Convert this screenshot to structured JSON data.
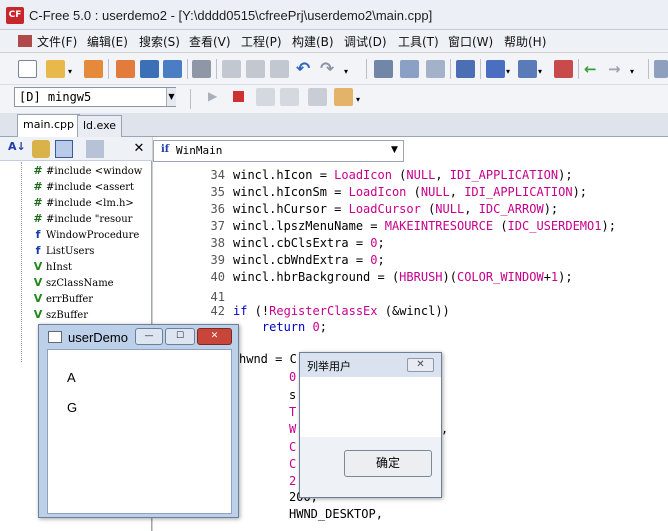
{
  "window": {
    "title": "C-Free 5.0 : userdemo2 - [Y:\\dddd0515\\cfreePrj\\userdemo2\\main.cpp]",
    "icon": "cfree-app-icon"
  },
  "menu": [
    {
      "label": "文件(F)"
    },
    {
      "label": "编辑(E)"
    },
    {
      "label": "搜索(S)"
    },
    {
      "label": "查看(V)"
    },
    {
      "label": "工程(P)"
    },
    {
      "label": "构建(B)"
    },
    {
      "label": "调试(D)"
    },
    {
      "label": "工具(T)"
    },
    {
      "label": "窗口(W)"
    },
    {
      "label": "帮助(H)"
    }
  ],
  "compiler": {
    "selected": "[D] mingw5"
  },
  "tabs": [
    {
      "label": "main.cpp",
      "active": true
    },
    {
      "label": "ld.exe",
      "active": false
    }
  ],
  "function_box": {
    "value": "WinMain"
  },
  "tree": [
    {
      "glyph": "#",
      "label": "#include <window"
    },
    {
      "glyph": "#",
      "label": "#include <assert"
    },
    {
      "glyph": "#",
      "label": "#include <lm.h>"
    },
    {
      "glyph": "#",
      "label": "#include \"resour"
    },
    {
      "glyph": "f",
      "label": "WindowProcedure"
    },
    {
      "glyph": "f",
      "label": "ListUsers"
    },
    {
      "glyph": "V",
      "label": "hInst"
    },
    {
      "glyph": "V",
      "label": "szClassName"
    },
    {
      "glyph": "V",
      "label": "errBuffer"
    },
    {
      "glyph": "V",
      "label": "szBuffer"
    }
  ],
  "code_lines": [
    {
      "n": "34",
      "text": "wincl.hIcon = LoadIcon (NULL, IDI_APPLICATION);"
    },
    {
      "n": "35",
      "text": "wincl.hIconSm = LoadIcon (NULL, IDI_APPLICATION);"
    },
    {
      "n": "36",
      "text": "wincl.hCursor = LoadCursor (NULL, IDC_ARROW);"
    },
    {
      "n": "37",
      "text": "wincl.lpszMenuName = MAKEINTRESOURCE (IDC_USERDEMO1);"
    },
    {
      "n": "38",
      "text": "wincl.cbClsExtra = 0;"
    },
    {
      "n": "39",
      "text": "wincl.cbWndExtra = 0;"
    },
    {
      "n": "40",
      "text": "wincl.hbrBackground = (HBRUSH)(COLOR_WINDOW+1);"
    },
    {
      "n": "41",
      "text": ""
    },
    {
      "n": "42",
      "text": "if (!RegisterClassEx (&wincl))"
    },
    {
      "n": "",
      "text": "    return 0;"
    }
  ],
  "code_fragments": {
    "hwnd": "hwnd = C",
    "l1": "0",
    "l2": "s",
    "l3": "T",
    "l4": "W",
    "l4b": ",",
    "l5": "C",
    "l6": "C",
    "l7": "2",
    "l8": "200,",
    "l9": "HWND_DESKTOP,"
  },
  "user_demo": {
    "title": "userDemo",
    "items": [
      "A",
      "G"
    ]
  },
  "dialog": {
    "title": "列举用户",
    "ok_label": "确定"
  }
}
